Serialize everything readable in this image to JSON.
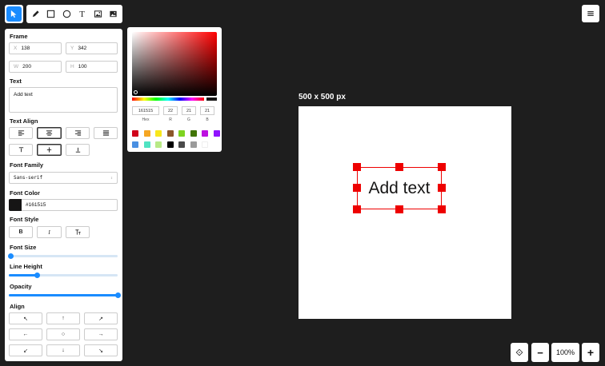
{
  "toolbar": {
    "tools": [
      {
        "name": "select-tool",
        "icon": "cursor-icon"
      },
      {
        "name": "pen-tool",
        "icon": "pen-icon"
      },
      {
        "name": "rectangle-tool",
        "icon": "square-icon"
      },
      {
        "name": "ellipse-tool",
        "icon": "circle-icon"
      },
      {
        "name": "text-tool",
        "icon": "text-t-icon",
        "glyph": "T"
      },
      {
        "name": "image-tool",
        "icon": "image-icon"
      },
      {
        "name": "image-upload-tool",
        "icon": "image-filled-icon"
      }
    ],
    "menu_icon": "hamburger-menu-icon"
  },
  "panel": {
    "frame": {
      "title": "Frame",
      "x_label": "X",
      "x_value": "138",
      "y_label": "Y",
      "y_value": "342",
      "w_label": "W",
      "w_value": "200",
      "h_label": "H",
      "h_value": "100"
    },
    "text": {
      "title": "Text",
      "value": "Add text"
    },
    "text_align": {
      "title": "Text Align"
    },
    "font_family": {
      "title": "Font Family",
      "value": "Sans-serif"
    },
    "font_color": {
      "title": "Font Color",
      "value": "#161515",
      "swatch": "#161515"
    },
    "font_style": {
      "title": "Font Style",
      "bold": "B",
      "italic": "I"
    },
    "font_size": {
      "title": "Font Size",
      "level": 0.02
    },
    "line_height": {
      "title": "Line Height",
      "level": 0.26
    },
    "opacity": {
      "title": "Opacity",
      "level": 1.0
    },
    "align": {
      "title": "Align",
      "arrows": [
        "↖",
        "↑",
        "↗",
        "←",
        "○",
        "→",
        "↙",
        "↓",
        "↘"
      ]
    }
  },
  "picker": {
    "hex_value": "161515",
    "r_value": "22",
    "g_value": "21",
    "b_value": "21",
    "hex_label": "Hex",
    "r_label": "R",
    "g_label": "G",
    "b_label": "B",
    "swatches_row1": [
      "#d0021b",
      "#f5a623",
      "#f8e71c",
      "#8b572a",
      "#7ed321",
      "#417505",
      "#bd10e0",
      "#9013fe"
    ],
    "swatches_row2": [
      "#4a90e2",
      "#50e3c2",
      "#b8e986",
      "#000000",
      "#4a4a4a",
      "#9b9b9b",
      "#ffffff"
    ]
  },
  "canvas": {
    "size_label": "500 x 500 px",
    "text_element": "Add text",
    "selection_color": "#ee0000"
  },
  "zoom": {
    "level": "100%",
    "minus": "−",
    "plus": "+"
  },
  "colors": {
    "accent": "#1a8cff",
    "background": "#1e1e1e"
  }
}
